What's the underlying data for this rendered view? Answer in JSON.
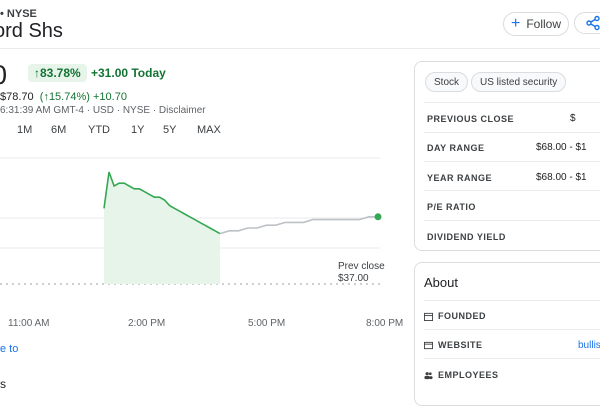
{
  "header": {
    "exchange": "• NYSE",
    "name": "ord Shs",
    "follow_label": "Follow"
  },
  "quote": {
    "price": "0",
    "change_pct": "83.78%",
    "change_today": "+31.00 Today",
    "after_hours_price": "$78.70",
    "after_hours_pct": "(↑15.74%)",
    "after_hours_change": "+10.70",
    "meta": "6:31:39 AM GMT-4 · USD · NYSE · Disclaimer"
  },
  "ranges": [
    "1M",
    "6M",
    "YTD",
    "1Y",
    "5Y",
    "MAX"
  ],
  "chart": {
    "x_labels": [
      "11:00 AM",
      "2:00 PM",
      "5:00 PM",
      "8:00 PM"
    ],
    "prev_close_label": "Prev close",
    "prev_close_value": "$37.00",
    "colors": {
      "up": "#34a853",
      "after": "#bdc1c6",
      "fill": "#e6f4ea"
    }
  },
  "chart_data": {
    "type": "line",
    "x_labels": [
      "11:00 AM",
      "2:00 PM",
      "5:00 PM",
      "8:00 PM"
    ],
    "series": [
      {
        "values": [
          62,
          75,
          70,
          71,
          71,
          70,
          69,
          69,
          68,
          67,
          66,
          66,
          65,
          63,
          62,
          61,
          60,
          59,
          58,
          57,
          56,
          55,
          54,
          53
        ]
      },
      {
        "values": [
          53,
          54,
          54,
          55,
          55,
          56,
          56,
          57,
          57,
          57,
          58,
          58,
          58,
          58,
          58,
          58,
          59,
          59
        ]
      }
    ],
    "reference_line": 37
  },
  "link_text": "e to",
  "section_letter": "s",
  "chips": [
    "Stock",
    "US listed security"
  ],
  "stats": [
    {
      "label": "PREVIOUS CLOSE",
      "value": "$"
    },
    {
      "label": "DAY RANGE",
      "value": "$68.00 - $1"
    },
    {
      "label": "YEAR RANGE",
      "value": "$68.00 - $1"
    },
    {
      "label": "P/E RATIO",
      "value": ""
    },
    {
      "label": "DIVIDEND YIELD",
      "value": ""
    }
  ],
  "about": {
    "title": "About",
    "rows": [
      {
        "label": "FOUNDED",
        "value": ""
      },
      {
        "label": "WEBSITE",
        "value": "bullis"
      },
      {
        "label": "EMPLOYEES",
        "value": ""
      }
    ]
  }
}
